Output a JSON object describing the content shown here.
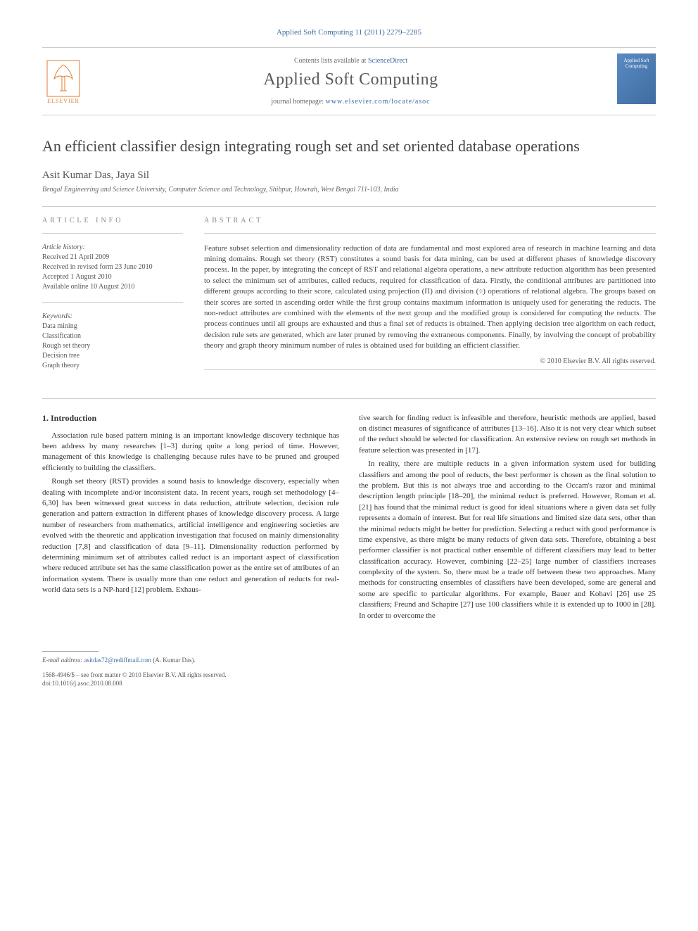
{
  "header": {
    "citation": "Applied Soft Computing 11 (2011) 2279–2285",
    "contents_prefix": "Contents lists available at ",
    "contents_link": "ScienceDirect",
    "journal_name": "Applied Soft Computing",
    "homepage_prefix": "journal homepage: ",
    "homepage_url": "www.elsevier.com/locate/asoc",
    "publisher": "ELSEVIER",
    "cover_text": "Applied Soft Computing"
  },
  "paper": {
    "title": "An efficient classifier design integrating rough set and set oriented database operations",
    "authors": "Asit Kumar Das, Jaya Sil",
    "affiliation": "Bengal Engineering and Science University, Computer Science and Technology, Shibpur, Howrah, West Bengal 711-103, India"
  },
  "article_info": {
    "heading": "ARTICLE INFO",
    "history_title": "Article history:",
    "received": "Received 21 April 2009",
    "revised": "Received in revised form 23 June 2010",
    "accepted": "Accepted 1 August 2010",
    "online": "Available online 10 August 2010",
    "keywords_title": "Keywords:",
    "keywords": [
      "Data mining",
      "Classification",
      "Rough set theory",
      "Decision tree",
      "Graph theory"
    ]
  },
  "abstract": {
    "heading": "ABSTRACT",
    "text": "Feature subset selection and dimensionality reduction of data are fundamental and most explored area of research in machine learning and data mining domains. Rough set theory (RST) constitutes a sound basis for data mining, can be used at different phases of knowledge discovery process. In the paper, by integrating the concept of RST and relational algebra operations, a new attribute reduction algorithm has been presented to select the minimum set of attributes, called reducts, required for classification of data. Firstly, the conditional attributes are partitioned into different groups according to their score, calculated using projection (Π) and division (÷) operations of relational algebra. The groups based on their scores are sorted in ascending order while the first group contains maximum information is uniquely used for generating the reducts. The non-reduct attributes are combined with the elements of the next group and the modified group is considered for computing the reducts. The process continues until all groups are exhausted and thus a final set of reducts is obtained. Then applying decision tree algorithm on each reduct, decision rule sets are generated, which are later pruned by removing the extraneous components. Finally, by involving the concept of probability theory and graph theory minimum number of rules is obtained used for building an efficient classifier.",
    "copyright": "© 2010 Elsevier B.V. All rights reserved."
  },
  "body": {
    "section_heading": "1. Introduction",
    "col1_paras": [
      "Association rule based pattern mining is an important knowledge discovery technique has been address by many researches [1–3] during quite a long period of time. However, management of this knowledge is challenging because rules have to be pruned and grouped efficiently to building the classifiers.",
      "Rough set theory (RST) provides a sound basis to knowledge discovery, especially when dealing with incomplete and/or inconsistent data. In recent years, rough set methodology [4–6,30] has been witnessed great success in data reduction, attribute selection, decision rule generation and pattern extraction in different phases of knowledge discovery process. A large number of researchers from mathematics, artificial intelligence and engineering societies are evolved with the theoretic and application investigation that focused on mainly dimensionality reduction [7,8] and classification of data [9–11]. Dimensionality reduction performed by determining minimum set of attributes called reduct is an important aspect of classification where reduced attribute set has the same classification power as the entire set of attributes of an information system. There is usually more than one reduct and generation of reducts for real-world data sets is a NP-hard [12] problem. Exhaus-"
    ],
    "col2_paras": [
      "tive search for finding reduct is infeasible and therefore, heuristic methods are applied, based on distinct measures of significance of attributes [13–16]. Also it is not very clear which subset of the reduct should be selected for classification. An extensive review on rough set methods in feature selection was presented in [17].",
      "In reality, there are multiple reducts in a given information system used for building classifiers and among the pool of reducts, the best performer is chosen as the final solution to the problem. But this is not always true and according to the Occam's razor and minimal description length principle [18–20], the minimal reduct is preferred. However, Roman et al. [21] has found that the minimal reduct is good for ideal situations where a given data set fully represents a domain of interest. But for real life situations and limited size data sets, other than the minimal reducts might be better for prediction. Selecting a reduct with good performance is time expensive, as there might be many reducts of given data sets. Therefore, obtaining a best performer classifier is not practical rather ensemble of different classifiers may lead to better classification accuracy. However, combining [22–25] large number of classifiers increases complexity of the system. So, there must be a trade off between these two approaches. Many methods for constructing ensembles of classifiers have been developed, some are general and some are specific to particular algorithms. For example, Bauer and Kohavi [26] use 25 classifiers; Freund and Schapire [27] use 100 classifiers while it is extended up to 1000 in [28]. In order to overcome the"
    ]
  },
  "footer": {
    "email_label": "E-mail address:",
    "email": "asitdas72@rediffmail.com",
    "email_author": "(A. Kumar Das).",
    "issn": "1568-4946/$ – see front matter © 2010 Elsevier B.V. All rights reserved.",
    "doi": "doi:10.1016/j.asoc.2010.08.008"
  }
}
